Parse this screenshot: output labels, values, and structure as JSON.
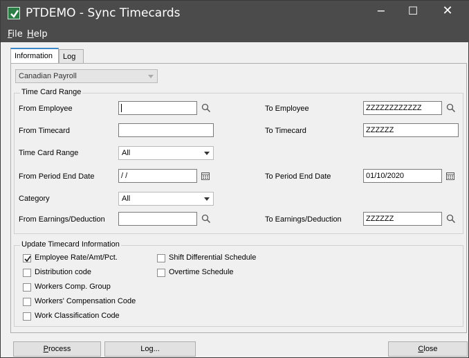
{
  "window": {
    "title": "PTDEMO - Sync Timecards",
    "controls": {
      "minimize": "−",
      "maximize": "☐",
      "close": "✕"
    }
  },
  "menu": {
    "file": {
      "accel": "F",
      "rest": "ile"
    },
    "help": {
      "accel": "H",
      "rest": "elp"
    }
  },
  "tabs": {
    "information": "Information",
    "log": "Log"
  },
  "payroll_select": {
    "value": "Canadian Payroll"
  },
  "time_card_range": {
    "title": "Time Card Range",
    "from_employee": {
      "label": "From Employee",
      "value": ""
    },
    "to_employee": {
      "label": "To Employee",
      "value": "ZZZZZZZZZZZZ"
    },
    "from_timecard": {
      "label": "From Timecard",
      "value": ""
    },
    "to_timecard": {
      "label": "To Timecard",
      "value": "ZZZZZZ"
    },
    "range": {
      "label": "Time Card Range",
      "value": "All"
    },
    "from_period": {
      "label": "From Period End Date",
      "value": " / /"
    },
    "to_period": {
      "label": "To Period End Date",
      "value": "01/10/2020"
    },
    "category": {
      "label": "Category",
      "value": "All"
    },
    "from_earnings": {
      "label": "From Earnings/Deduction",
      "value": ""
    },
    "to_earnings": {
      "label": "To Earnings/Deduction",
      "value": "ZZZZZZ"
    }
  },
  "update_info": {
    "title": "Update Timecard Information",
    "options": [
      {
        "label": "Employee Rate/Amt/Pct.",
        "checked": true
      },
      {
        "label": "Distribution code",
        "checked": false
      },
      {
        "label": "Workers Comp. Group",
        "checked": false
      },
      {
        "label": "Workers' Compensation Code",
        "checked": false
      },
      {
        "label": "Work Classification Code",
        "checked": false
      },
      {
        "label": "Shift Differential Schedule",
        "checked": false
      },
      {
        "label": "Overtime Schedule",
        "checked": false
      }
    ]
  },
  "buttons": {
    "process": {
      "accel": "P",
      "rest": "rocess"
    },
    "log": "Log...",
    "close": {
      "accel": "C",
      "rest": "lose"
    }
  }
}
